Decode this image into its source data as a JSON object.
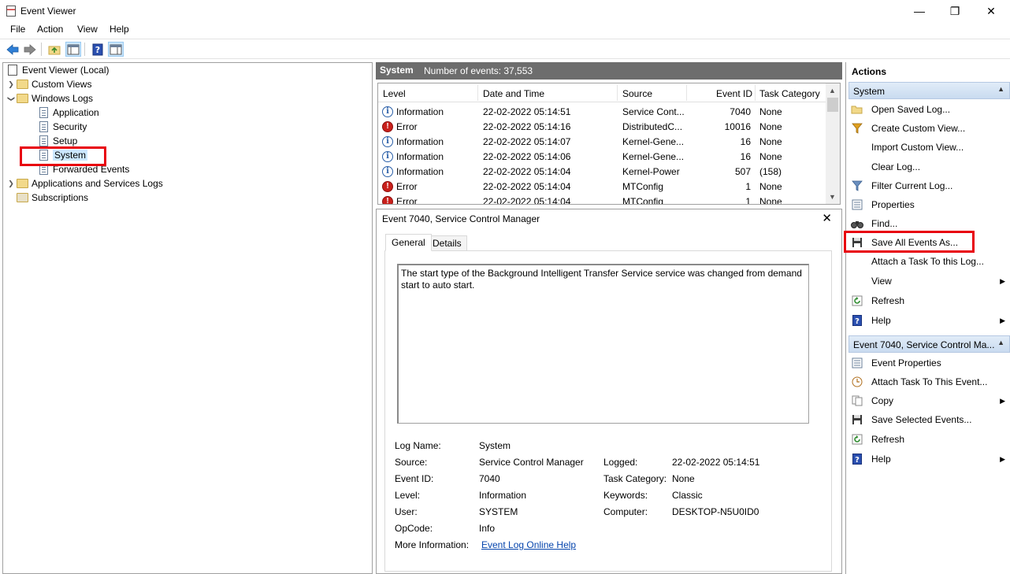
{
  "window": {
    "title": "Event Viewer",
    "min": "—",
    "restore": "❐",
    "close": "✕"
  },
  "menu": [
    "File",
    "Action",
    "View",
    "Help"
  ],
  "tree": {
    "root": "Event Viewer (Local)",
    "custom_views": "Custom Views",
    "windows_logs": "Windows Logs",
    "application": "Application",
    "security": "Security",
    "setup": "Setup",
    "system": "System",
    "forwarded": "Forwarded Events",
    "app_services": "Applications and Services Logs",
    "subscriptions": "Subscriptions"
  },
  "center": {
    "title": "System",
    "count": "Number of events: 37,553",
    "columns": [
      "Level",
      "Date and Time",
      "Source",
      "Event ID",
      "Task Category"
    ],
    "rows": [
      {
        "level": "Information",
        "type": "info",
        "date": "22-02-2022 05:14:51",
        "source": "Service Cont...",
        "id": "7040",
        "task": "None"
      },
      {
        "level": "Error",
        "type": "error",
        "date": "22-02-2022 05:14:16",
        "source": "DistributedC...",
        "id": "10016",
        "task": "None"
      },
      {
        "level": "Information",
        "type": "info",
        "date": "22-02-2022 05:14:07",
        "source": "Kernel-Gene...",
        "id": "16",
        "task": "None"
      },
      {
        "level": "Information",
        "type": "info",
        "date": "22-02-2022 05:14:06",
        "source": "Kernel-Gene...",
        "id": "16",
        "task": "None"
      },
      {
        "level": "Information",
        "type": "info",
        "date": "22-02-2022 05:14:04",
        "source": "Kernel-Power",
        "id": "507",
        "task": "(158)"
      },
      {
        "level": "Error",
        "type": "error",
        "date": "22-02-2022 05:14:04",
        "source": "MTConfig",
        "id": "1",
        "task": "None"
      },
      {
        "level": "Error",
        "type": "error",
        "date": "22-02-2022 05:14:04",
        "source": "MTConfig",
        "id": "1",
        "task": "None"
      }
    ]
  },
  "detail": {
    "title": "Event 7040, Service Control Manager",
    "tabs": [
      "General",
      "Details"
    ],
    "description": "The start type of the Background Intelligent Transfer Service service was changed from demand start to auto start.",
    "labels": {
      "log_name": "Log Name:",
      "source": "Source:",
      "event_id": "Event ID:",
      "level": "Level:",
      "user": "User:",
      "opcode": "OpCode:",
      "more_info": "More Information:",
      "logged": "Logged:",
      "task_category": "Task Category:",
      "keywords": "Keywords:",
      "computer": "Computer:"
    },
    "values": {
      "log_name": "System",
      "source": "Service Control Manager",
      "event_id": "7040",
      "level": "Information",
      "user": "SYSTEM",
      "opcode": "Info",
      "more_info": "Event Log Online Help",
      "logged": "22-02-2022 05:14:51",
      "task_category": "None",
      "keywords": "Classic",
      "computer": "DESKTOP-N5U0ID0"
    }
  },
  "actions": {
    "title": "Actions",
    "section1": "System",
    "items1": [
      "Open Saved Log...",
      "Create Custom View...",
      "Import Custom View...",
      "Clear Log...",
      "Filter Current Log...",
      "Properties",
      "Find...",
      "Save All Events As...",
      "Attach a Task To this Log...",
      "View",
      "Refresh",
      "Help"
    ],
    "section2": "Event 7040, Service Control Ma...",
    "items2": [
      "Event Properties",
      "Attach Task To This Event...",
      "Copy",
      "Save Selected Events...",
      "Refresh",
      "Help"
    ]
  },
  "colors": {
    "highlight": "#e8000d",
    "selection": "#cce8ff",
    "header_bg": "#6d6d6d",
    "link": "#0645ad"
  }
}
